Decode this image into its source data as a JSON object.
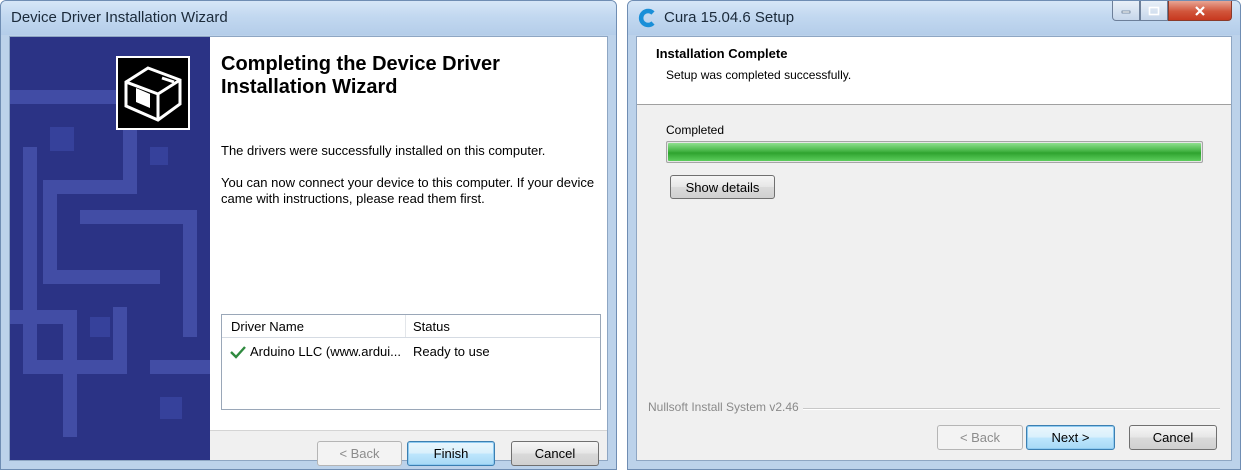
{
  "driver_wizard": {
    "title": "Device Driver Installation Wizard",
    "heading": "Completing the Device Driver Installation Wizard",
    "message1": "The drivers were successfully installed on this computer.",
    "message2": "You can now connect your device to this computer. If your device came with instructions, please read them first.",
    "table": {
      "headers": [
        "Driver Name",
        "Status"
      ],
      "rows": [
        {
          "icon": "checkmark-icon",
          "name": "Arduino LLC (www.ardui...",
          "status": "Ready to use"
        }
      ]
    },
    "buttons": {
      "back": "< Back",
      "finish": "Finish",
      "cancel": "Cancel"
    },
    "banner_color": "#2b3385"
  },
  "cura_setup": {
    "title": "Cura 15.04.6 Setup",
    "header_title": "Installation Complete",
    "header_subtitle": "Setup was completed successfully.",
    "status": "Completed",
    "progress": 1.0,
    "show_details": "Show details",
    "branding": "Nullsoft Install System v2.46",
    "buttons": {
      "back": "< Back",
      "next": "Next >",
      "cancel": "Cancel"
    },
    "progress_color": "#3cb43c",
    "icon_color": "#1a8fd8"
  }
}
